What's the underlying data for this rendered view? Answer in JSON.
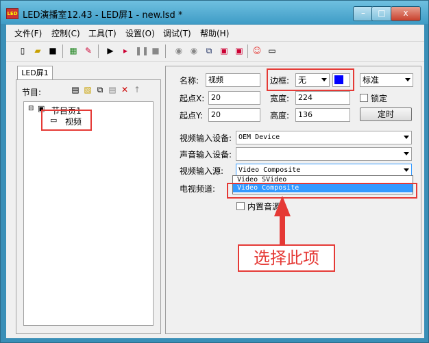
{
  "window": {
    "title": "LED演播室12.43 - LED屏1 - new.lsd *",
    "app_icon_text": "LED"
  },
  "window_buttons": {
    "minimize": "–",
    "maximize": "□",
    "close": "x"
  },
  "menu": [
    "文件(F)",
    "控制(C)",
    "工具(T)",
    "设置(O)",
    "调试(T)",
    "帮助(H)"
  ],
  "toolbar_icons": [
    "new-file-icon",
    "open-folder-icon",
    "save-icon",
    "grid-icon",
    "edit-icon",
    "play-icon",
    "step-play-icon",
    "pause-icon",
    "stop-icon",
    "screen1-icon",
    "screen2-icon",
    "network-icon",
    "display-red-icon",
    "display-gray-icon",
    "smiley-icon",
    "monitor-icon"
  ],
  "tab": {
    "label": "LED屏1"
  },
  "left": {
    "program_label": "节目:",
    "tree": {
      "page": "节目页1",
      "item": "视频"
    }
  },
  "props": {
    "name_label": "名称:",
    "name_value": "视频",
    "border_label": "边框:",
    "border_value": "无",
    "style_value": "标准",
    "x_label": "起点X:",
    "x_value": "20",
    "width_label": "宽度:",
    "width_value": "224",
    "lock_label": "锁定",
    "y_label": "起点Y:",
    "y_value": "20",
    "height_label": "高度:",
    "height_value": "136",
    "timer_button": "定时",
    "video_device_label": "视频输入设备:",
    "video_device_value": "OEM Device",
    "audio_device_label": "声音输入设备:",
    "audio_device_value": "",
    "video_source_label": "视频输入源:",
    "video_source_value": "Video Composite",
    "tv_channel_label": "电视频道:",
    "internal_audio_label": "内置音源"
  },
  "dropdown_options": [
    "Video SVideo",
    "Video Composite"
  ],
  "annotation": {
    "text": "选择此项"
  },
  "colors": {
    "accent": "#e53935",
    "selection": "#3399ff",
    "border_color_swatch": "#0000ff"
  }
}
